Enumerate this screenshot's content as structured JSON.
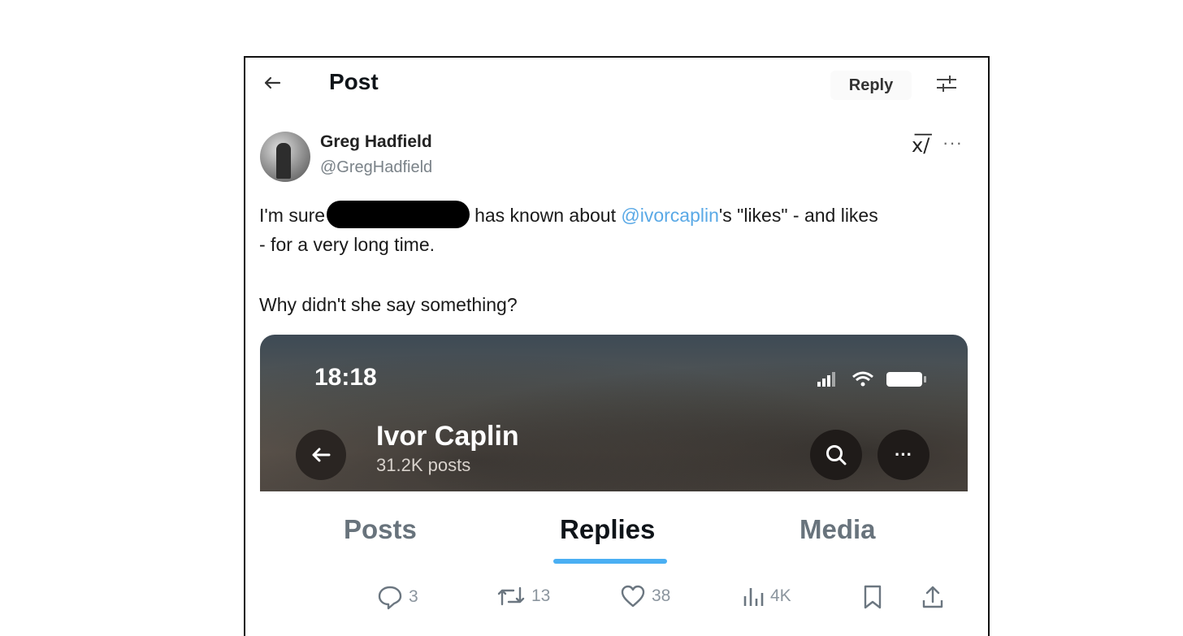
{
  "header": {
    "title": "Post",
    "reply_label": "Reply"
  },
  "author": {
    "name": "Greg Hadfield",
    "handle": "@GregHadfield"
  },
  "tweet": {
    "line1_prefix": "I'm sure",
    "line1_suffix": "has known about",
    "mention": "@ivorcaplin",
    "line1_end": "'s \"likes\" - and likes",
    "line2": "- for a very long time.",
    "line3": "Why didn't she say something?"
  },
  "embed": {
    "time": "18:18",
    "profile_name": "Ivor Caplin",
    "profile_posts": "31.2K posts",
    "tabs": [
      {
        "label": "Posts"
      },
      {
        "label": "Replies",
        "active": true
      },
      {
        "label": "Media"
      }
    ],
    "more_label": "···"
  },
  "actions": {
    "replies": "3",
    "reposts": "13",
    "likes": "38",
    "views": "4K"
  },
  "icons": {
    "back": "back-arrow-icon",
    "settings": "sliders-icon",
    "grok": "grok-icon",
    "more": "more-icon"
  },
  "colors": {
    "mention": "#5aa9e6",
    "tab_indicator": "#1d9bf0"
  }
}
